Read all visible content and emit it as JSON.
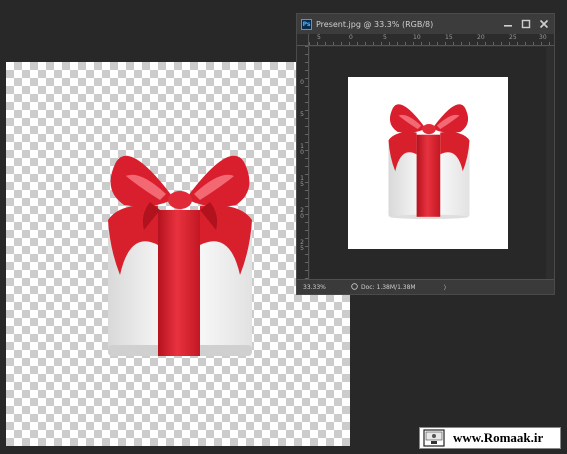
{
  "window": {
    "title": "Present.jpg @ 33.3% (RGB/8)",
    "app_logo": "Ps",
    "controls": [
      "minimize-icon",
      "maximize-icon",
      "close-icon"
    ]
  },
  "rulers": {
    "top_labels": [
      "5",
      "0",
      "5",
      "10",
      "15",
      "20",
      "25",
      "30"
    ],
    "left_labels": [
      "0",
      "5",
      "1 0",
      "1 5",
      "2 0",
      "2 5"
    ]
  },
  "status": {
    "zoom": "33.33%",
    "doc_info": "Doc: 1.38M/1.38M",
    "arrow": "〉"
  },
  "watermark": {
    "text": "www.Romaak.ir"
  },
  "colors": {
    "workspace": "#282828",
    "ribbon": "#d81f2c",
    "ribbon_highlight": "#f15a63",
    "box": "#ececec"
  }
}
